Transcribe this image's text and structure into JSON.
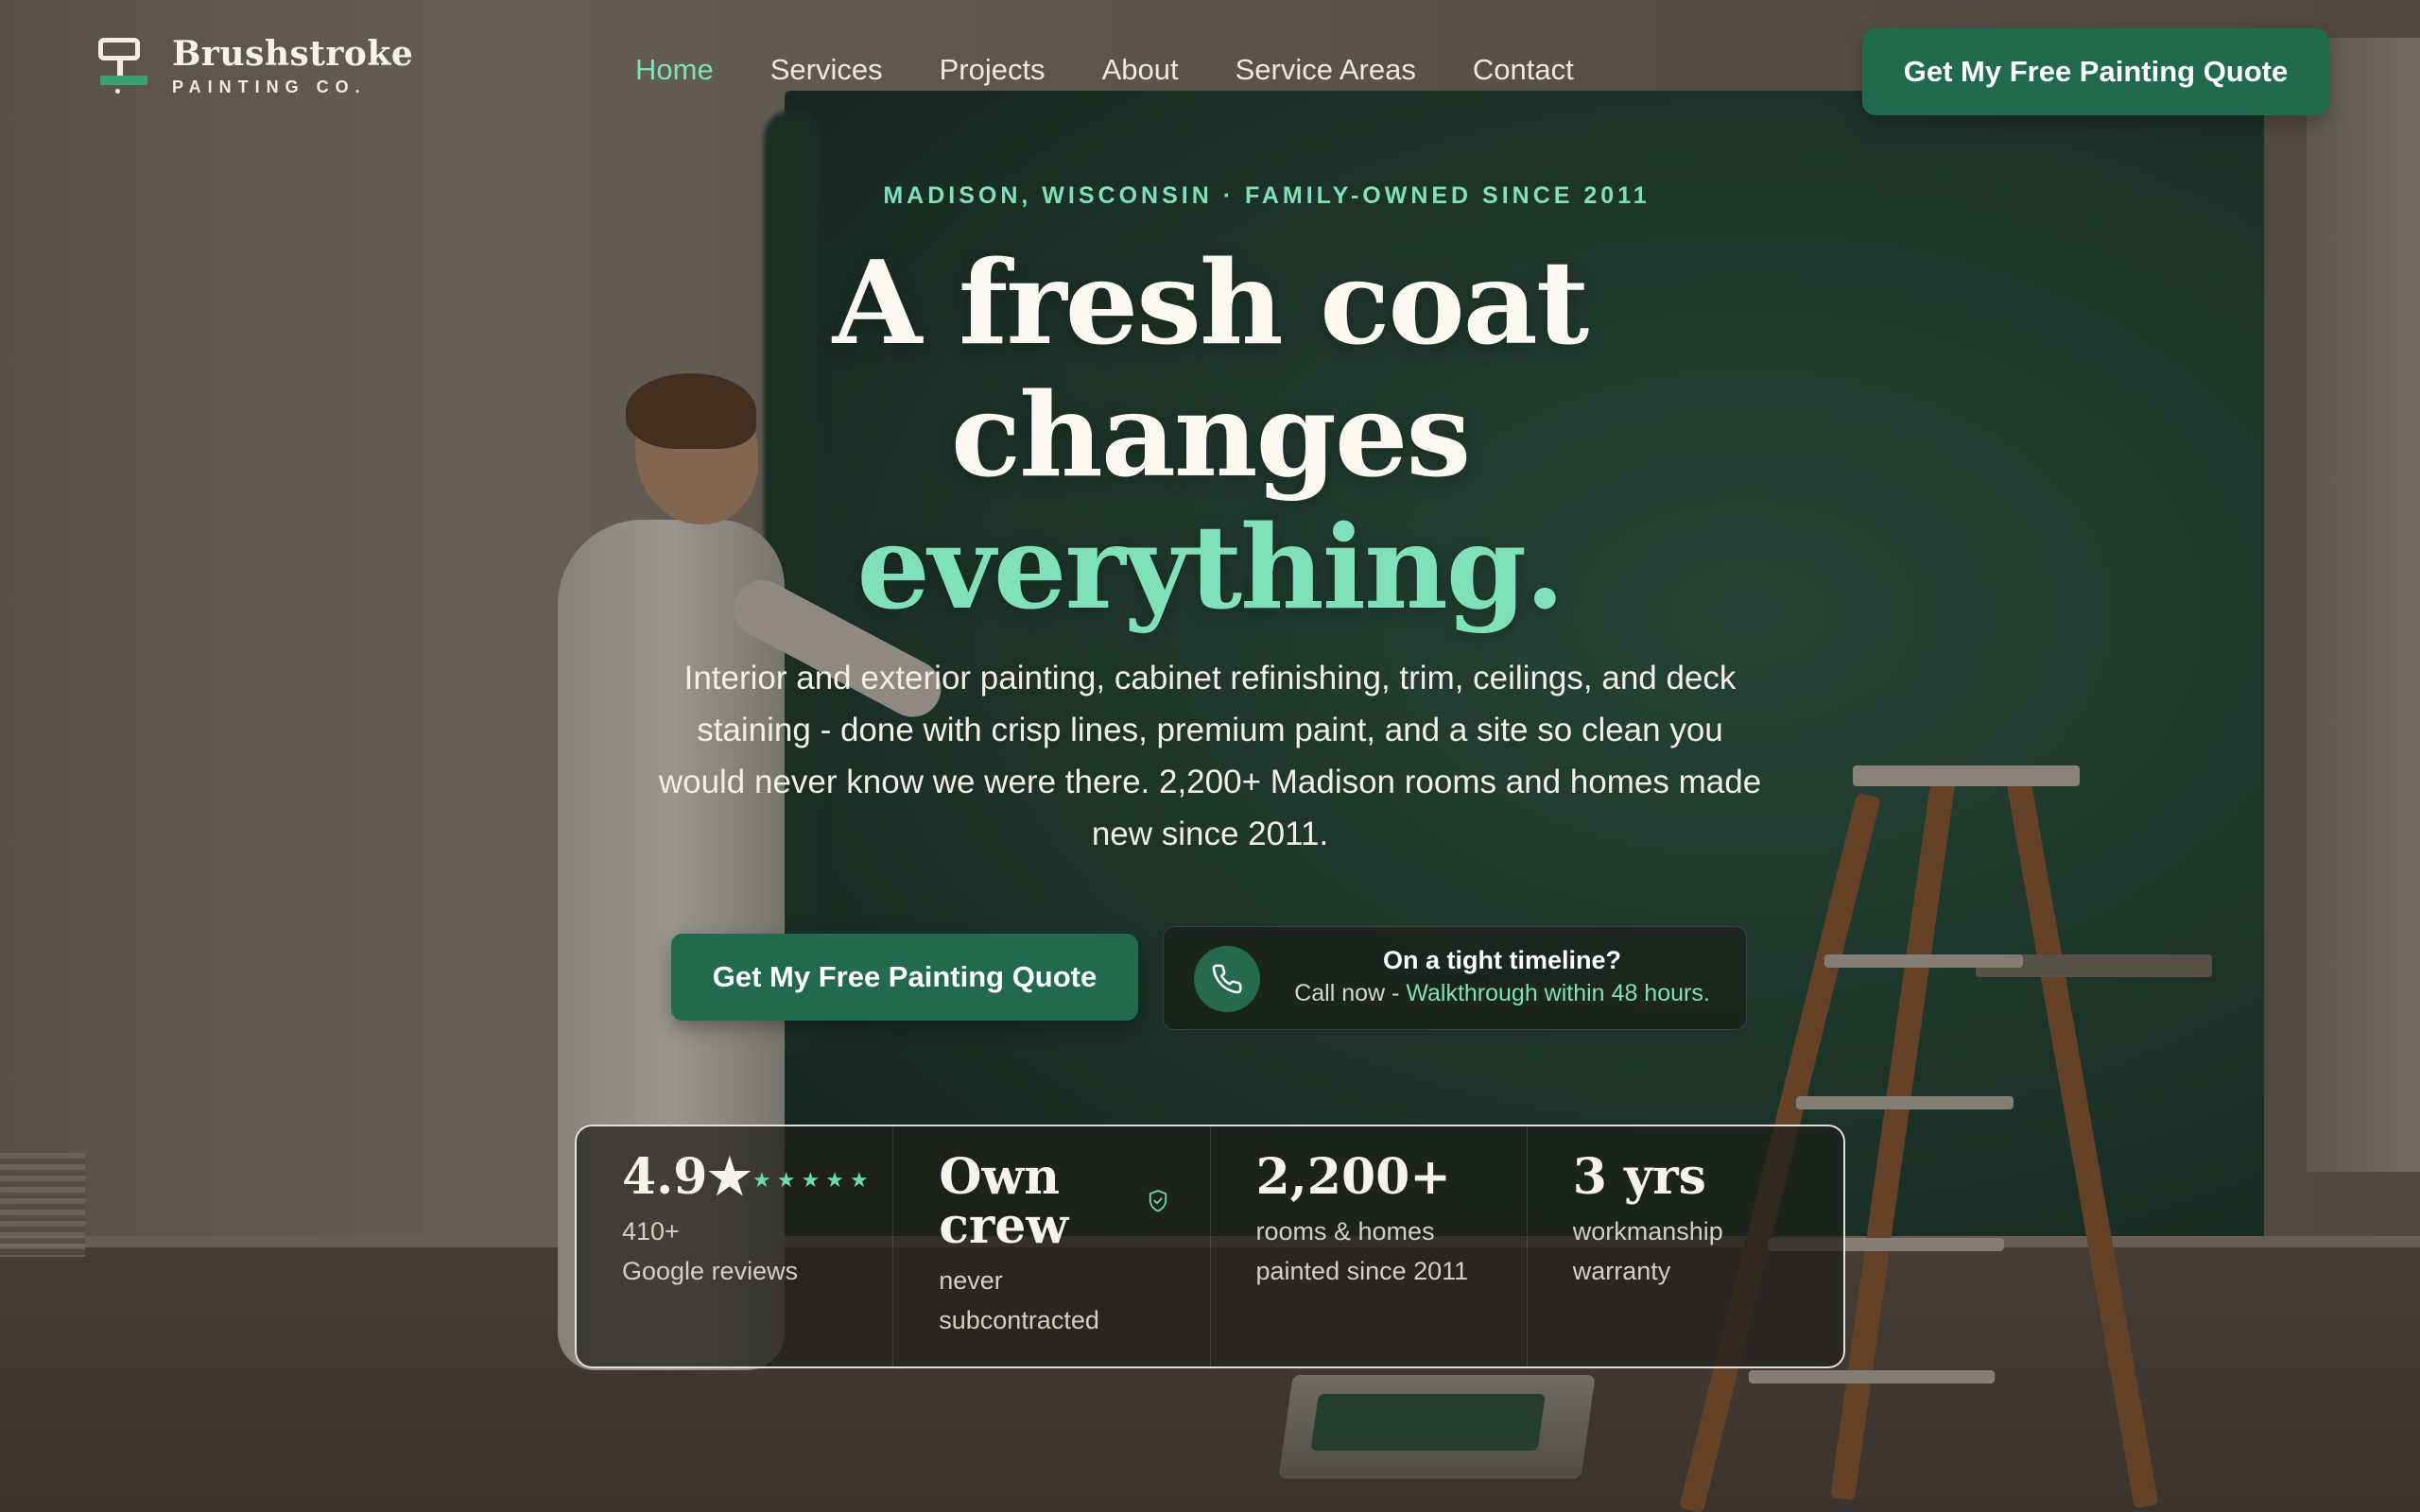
{
  "brand": {
    "name": "Brushstroke",
    "tagline": "PAINTING CO."
  },
  "nav": {
    "items": [
      {
        "label": "Home",
        "active": true
      },
      {
        "label": "Services",
        "active": false
      },
      {
        "label": "Projects",
        "active": false
      },
      {
        "label": "About",
        "active": false
      },
      {
        "label": "Service Areas",
        "active": false
      },
      {
        "label": "Contact",
        "active": false
      }
    ],
    "cta_label": "Get My Free Painting Quote"
  },
  "hero": {
    "eyebrow": "MADISON, WISCONSIN · FAMILY-OWNED SINCE 2011",
    "headline_line1": "A fresh coat",
    "headline_line2": "changes",
    "headline_line3": "everything.",
    "subcopy": "Interior and exterior painting, cabinet refinishing, trim, ceilings, and deck staining - done with crisp lines, premium paint, and a site so clean you would never know we were there. 2,200+ Madison rooms and homes made new since 2011.",
    "cta_label": "Get My Free Painting Quote",
    "call": {
      "title": "On a tight timeline?",
      "prefix": "Call now - ",
      "highlight": "Walkthrough within 48 hours."
    }
  },
  "stats": [
    {
      "big": "4.9★",
      "line1": "410+",
      "line2": "Google reviews",
      "stars": 5
    },
    {
      "big_line1": "Own",
      "big_line2": "crew",
      "line1": "never",
      "line2": "subcontracted"
    },
    {
      "big": "2,200+",
      "line1": "rooms & homes",
      "line2": "painted since 2011"
    },
    {
      "big": "3 yrs",
      "line1": "workmanship",
      "line2": "warranty"
    }
  ],
  "colors": {
    "accent": "#7fe0bb",
    "button": "#226a4f",
    "wall_green": "#224438"
  },
  "icons": [
    "paint-roller-logo-icon",
    "phone-icon",
    "star-icon",
    "shield-check-icon"
  ]
}
